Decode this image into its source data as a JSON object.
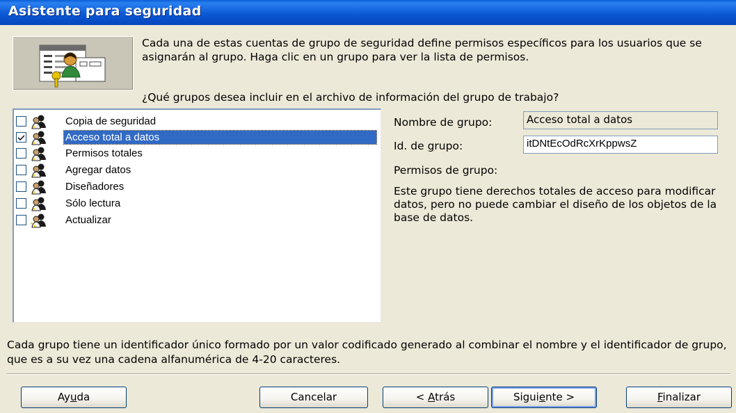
{
  "window": {
    "title": "Asistente para seguridad"
  },
  "intro_text": "Cada una de estas cuentas de grupo de seguridad define permisos específicos para los usuarios que se asignarán al grupo. Haga clic en un grupo para ver la lista de permisos.",
  "question": "¿Qué grupos desea incluir en el archivo de información del grupo de trabajo?",
  "groups": [
    {
      "label": "Copia de seguridad",
      "checked": false,
      "selected": false
    },
    {
      "label": "Acceso total a datos",
      "checked": true,
      "selected": true
    },
    {
      "label": "Permisos totales",
      "checked": false,
      "selected": false
    },
    {
      "label": "Agregar datos",
      "checked": false,
      "selected": false
    },
    {
      "label": "Diseñadores",
      "checked": false,
      "selected": false
    },
    {
      "label": "Sólo lectura",
      "checked": false,
      "selected": false
    },
    {
      "label": "Actualizar",
      "checked": false,
      "selected": false
    }
  ],
  "details": {
    "name_label": "Nombre de grupo:",
    "name_value": "Acceso total a datos",
    "id_label_pre": "Id. de ",
    "id_label_key": "g",
    "id_label_post": "rupo:",
    "id_value": "itDNtEcOdRcXrKppwsZ",
    "perm_label": "Permisos de grupo:",
    "perm_description": "Este grupo tiene derechos totales de acceso para modificar datos, pero no puede cambiar el diseño de los objetos de la base de datos."
  },
  "footer_note": "Cada grupo tiene un identificador único formado por un valor codificado generado al combinar el nombre y el identificador de grupo, que es a su vez una cadena alfanumérica de 4-20 caracteres.",
  "buttons": {
    "help": {
      "pre": "Ay",
      "key": "u",
      "post": "da"
    },
    "cancel": {
      "pre": "Cancelar",
      "key": "",
      "post": ""
    },
    "back": {
      "pre": "< ",
      "key": "A",
      "post": "trás"
    },
    "next": {
      "pre": "Sigui",
      "key": "e",
      "post": "nte >"
    },
    "finish": {
      "pre": "",
      "key": "F",
      "post": "inalizar"
    }
  },
  "colors": {
    "title_bar": "#0b59d6",
    "selection": "#316ac5",
    "dialog_bg": "#ece9d8"
  }
}
